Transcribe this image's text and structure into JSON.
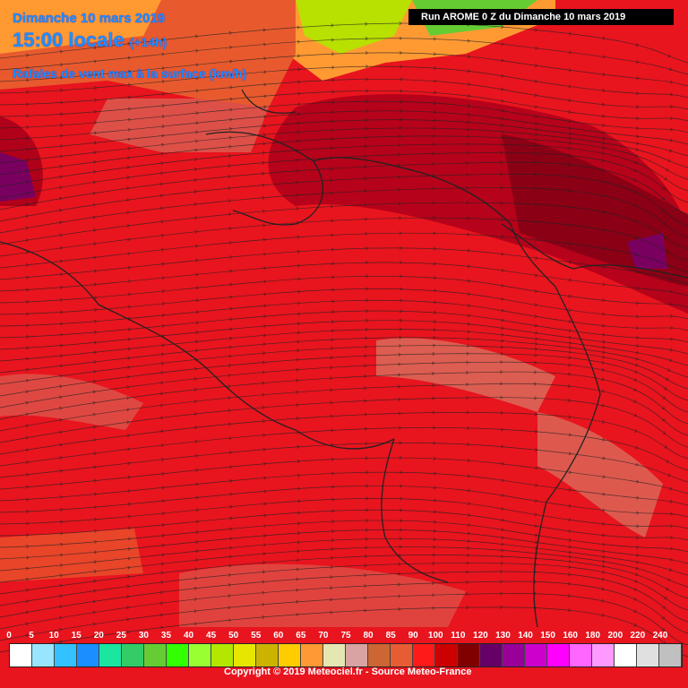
{
  "header": {
    "date": "Dimanche 10 mars 2019",
    "time": "15:00 locale",
    "offset": "(+14h)",
    "parameter": "Rafales de vent max à la surface (km/h)",
    "run": "Run AROME 0 Z du Dimanche 10 mars 2019"
  },
  "legend": {
    "labels": [
      "0",
      "5",
      "10",
      "15",
      "20",
      "25",
      "30",
      "35",
      "40",
      "45",
      "50",
      "55",
      "60",
      "65",
      "70",
      "75",
      "80",
      "85",
      "90",
      "100",
      "110",
      "120",
      "130",
      "140",
      "150",
      "160",
      "180",
      "200",
      "220",
      "240"
    ],
    "colors": [
      "#ffffff",
      "#99e5ff",
      "#33c2ff",
      "#1a8fff",
      "#1ae6a0",
      "#33cc66",
      "#66cc33",
      "#33ff00",
      "#99ff33",
      "#b3e600",
      "#e6e600",
      "#ccb300",
      "#ffcc00",
      "#ff9933",
      "#e6e6b3",
      "#d9a3a3",
      "#cc6633",
      "#e65c33",
      "#ff1a1a",
      "#cc0000",
      "#800000",
      "#660066",
      "#990099",
      "#cc00cc",
      "#ff00ff",
      "#ff66ff",
      "#ff99ff",
      "#ffffff",
      "#e0e0e0",
      "#c0c0c0"
    ]
  },
  "footer": {
    "copyright": "Copyright © 2019 Meteociel.fr - Source Meteo-France"
  },
  "colors": {
    "header_text": "#1e90ff",
    "base_field": "#e8141e",
    "dark_field": "#b0001a",
    "light_field": "#d96a5a"
  }
}
